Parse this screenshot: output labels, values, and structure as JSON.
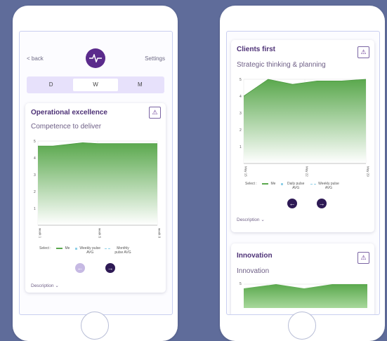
{
  "left_phone": {
    "back_label": "< back",
    "settings_label": "Settings",
    "tabs": [
      {
        "label": "D",
        "active": false
      },
      {
        "label": "W",
        "active": true
      },
      {
        "label": "M",
        "active": false
      }
    ],
    "card": {
      "title": "Operational excellence",
      "subtitle": "Competence to deliver",
      "chart_data": {
        "type": "area",
        "x": [
          "week 1",
          "week 5",
          "week 9"
        ],
        "y_ticks": [
          "1",
          "2",
          "3",
          "4",
          "5"
        ],
        "series": [
          {
            "name": "Me",
            "values": [
              4.7,
              4.7,
              4.8,
              4.9,
              4.85,
              4.85,
              4.85,
              4.85,
              4.85
            ]
          }
        ],
        "ylim": [
          0,
          5
        ]
      },
      "legend": {
        "select_label": "Select :",
        "items": [
          {
            "label": "Me",
            "color": "#5aa84d"
          },
          {
            "label": "Weekly pulse AVG",
            "color": "#8fd0e8"
          },
          {
            "label": "Monthly pulse AVG",
            "color": "#8fd0e8"
          }
        ]
      },
      "prev_arrow": "←",
      "next_arrow": "→",
      "description_label": "Description ⌄"
    }
  },
  "right_phone": {
    "card1": {
      "title": "Clients first",
      "subtitle": "Strategic thinking & planning",
      "chart_data": {
        "type": "area",
        "x": [
          "May 15",
          "May 22",
          "May 29"
        ],
        "y_ticks": [
          "1",
          "2",
          "3",
          "4",
          "5"
        ],
        "series": [
          {
            "name": "Me",
            "values": [
              4,
              5,
              4.7,
              4.9,
              4.9,
              5
            ]
          }
        ],
        "ylim": [
          0,
          5
        ]
      },
      "legend": {
        "select_label": "Select :",
        "items": [
          {
            "label": "Me",
            "color": "#5aa84d"
          },
          {
            "label": "Daily pulse AVG",
            "color": "#8fd0e8"
          },
          {
            "label": "Weekly pulse AVG",
            "color": "#8fd0e8"
          }
        ]
      },
      "prev_arrow": "←",
      "next_arrow": "→",
      "description_label": "Description ⌄"
    },
    "card2": {
      "title": "Innovation",
      "subtitle": "Innovation",
      "y_tick_top": "5"
    }
  },
  "colors": {
    "background": "#5f6c9a",
    "accent": "#5b2b8c",
    "area_green": "#5aa84d"
  }
}
